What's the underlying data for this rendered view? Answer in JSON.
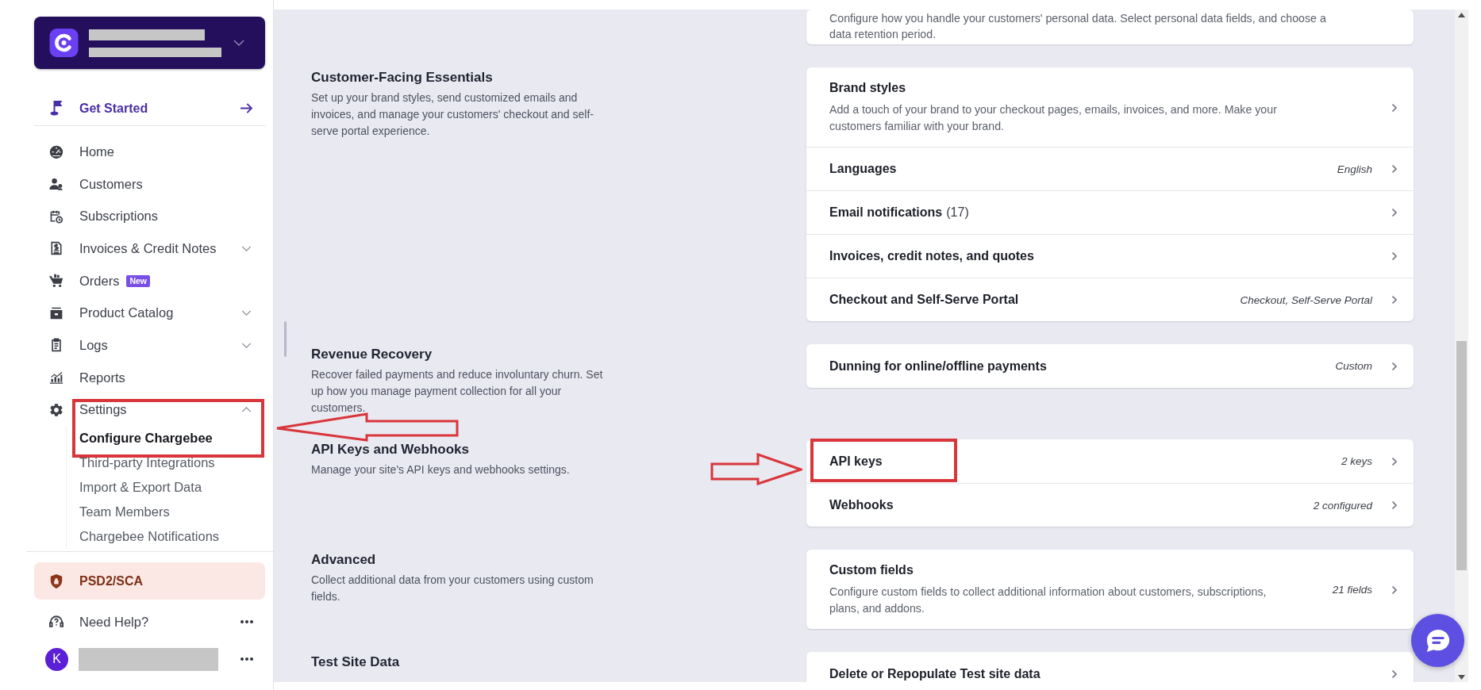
{
  "sidebar": {
    "get_started": {
      "label": "Get Started"
    },
    "nav": [
      {
        "kind": "link",
        "label": "Home"
      },
      {
        "kind": "link",
        "label": "Customers"
      },
      {
        "kind": "link",
        "label": "Subscriptions"
      },
      {
        "kind": "group",
        "label": "Invoices & Credit Notes",
        "expanded": false
      },
      {
        "kind": "link",
        "label": "Orders",
        "badge": "New"
      },
      {
        "kind": "group",
        "label": "Product Catalog",
        "expanded": false
      },
      {
        "kind": "group",
        "label": "Logs",
        "expanded": false
      },
      {
        "kind": "link",
        "label": "Reports"
      },
      {
        "kind": "group",
        "label": "Settings",
        "expanded": true,
        "children": [
          {
            "label": "Configure Chargebee",
            "selected": true
          },
          {
            "label": "Third-party Integrations",
            "selected": false
          },
          {
            "label": "Import & Export Data",
            "selected": false
          },
          {
            "label": "Team Members",
            "selected": false
          },
          {
            "label": "Chargebee Notifications",
            "selected": false
          }
        ]
      }
    ],
    "alert": {
      "label": "PSD2/SCA"
    },
    "help": {
      "label": "Need Help?"
    },
    "user": {
      "initial": "K"
    }
  },
  "sections": [
    {
      "rows": [
        {
          "kind": "text",
          "description": "Configure how you handle your customers' personal data. Select personal data fields, and choose a data retention period."
        }
      ]
    },
    {
      "title": "Customer-Facing Essentials",
      "description": "Set up your brand styles, send customized emails and invoices, and manage your customers' checkout and self-serve portal experience.",
      "rows": [
        {
          "kind": "link",
          "title": "Brand styles",
          "description": "Add a touch of your brand to your checkout pages, emails, invoices, and more. Make your customers familiar with your brand."
        },
        {
          "kind": "link",
          "title": "Languages",
          "value": "English"
        },
        {
          "kind": "link",
          "title": "Email notifications",
          "count": "(17)"
        },
        {
          "kind": "link",
          "title": "Invoices, credit notes, and quotes"
        },
        {
          "kind": "link",
          "title": "Checkout and Self-Serve Portal",
          "value": "Checkout, Self-Serve Portal"
        }
      ]
    },
    {
      "title": "Revenue Recovery",
      "description": "Recover failed payments and reduce involuntary churn. Set up how you manage payment collection for all your customers.",
      "rows": [
        {
          "kind": "link",
          "title": "Dunning for online/offline payments",
          "value": "Custom"
        }
      ]
    },
    {
      "title": "API Keys and Webhooks",
      "description": "Manage your site's API keys and webhooks settings.",
      "rows": [
        {
          "kind": "link",
          "title": "API keys",
          "value": "2 keys"
        },
        {
          "kind": "link",
          "title": "Webhooks",
          "value": "2 configured"
        }
      ]
    },
    {
      "title": "Advanced",
      "description": "Collect additional data from your customers using custom fields.",
      "rows": [
        {
          "kind": "link",
          "title": "Custom fields",
          "description": "Configure custom fields to collect additional information about customers, subscriptions, plans, and addons.",
          "value": "21 fields"
        }
      ]
    },
    {
      "title": "Test Site Data",
      "rows": [
        {
          "kind": "link",
          "title": "Delete or Repopulate Test site data"
        }
      ]
    }
  ]
}
